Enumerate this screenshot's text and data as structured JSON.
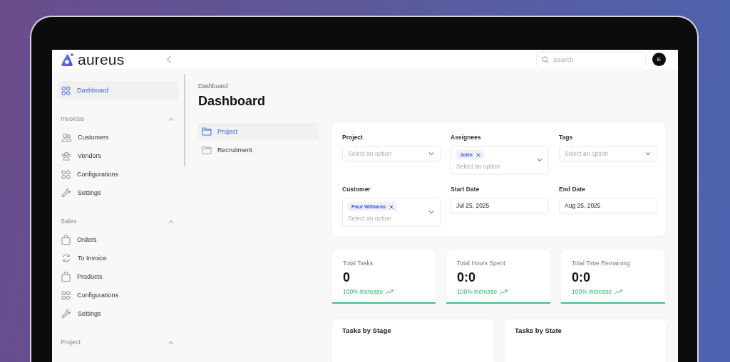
{
  "brand": {
    "name": "aureus"
  },
  "header": {
    "search": {
      "placeholder": "Search"
    },
    "avatar": {
      "initial": "E"
    }
  },
  "sidebar": {
    "top": [
      {
        "label": "Dashboard",
        "kind": "grid",
        "selected": true
      }
    ],
    "sections": [
      {
        "title": "Invoices",
        "expanded": true,
        "items": [
          {
            "label": "Customers",
            "kind": "users",
            "selected": false
          },
          {
            "label": "Vendors",
            "kind": "vendors",
            "selected": false
          },
          {
            "label": "Configurations",
            "kind": "grid",
            "selected": false
          },
          {
            "label": "Settings",
            "kind": "wrench",
            "selected": false
          }
        ]
      },
      {
        "title": "Sales",
        "expanded": true,
        "items": [
          {
            "label": "Orders",
            "kind": "bag",
            "selected": false
          },
          {
            "label": "To Invoice",
            "kind": "refresh",
            "selected": false
          },
          {
            "label": "Products",
            "kind": "bag",
            "selected": false
          },
          {
            "label": "Configurations",
            "kind": "grid",
            "selected": false
          },
          {
            "label": "Settings",
            "kind": "wrench",
            "selected": false
          }
        ]
      },
      {
        "title": "Project",
        "expanded": true
      }
    ]
  },
  "breadcrumb": "Dashboard",
  "page_title": "Dashboard",
  "sub_nav": [
    {
      "label": "Project",
      "selected": true
    },
    {
      "label": "Recruitment",
      "selected": false
    }
  ],
  "filters": [
    {
      "label": "Project",
      "kind": "select",
      "placeholder": "Select an option"
    },
    {
      "label": "Assignees",
      "kind": "multiselect",
      "chips": [
        "John"
      ],
      "placeholder": "Select an option"
    },
    {
      "label": "Tags",
      "kind": "select",
      "placeholder": "Select an option"
    },
    {
      "label": "Customer",
      "kind": "multiselect",
      "chips": [
        "Paul Williams"
      ],
      "placeholder": "Select an option"
    },
    {
      "label": "Start Date",
      "kind": "date",
      "value": "Jul 25, 2025"
    },
    {
      "label": "End Date",
      "kind": "date",
      "value": "Aug 25, 2025"
    }
  ],
  "stats": [
    {
      "label": "Total Tasks",
      "value": "0",
      "trend": "100% increase"
    },
    {
      "label": "Total Hours Spent",
      "value": "0:0",
      "trend": "100% increase"
    },
    {
      "label": "Total Time Remaining",
      "value": "0:0",
      "trend": "100% increase"
    }
  ],
  "panels": [
    {
      "title": "Tasks by Stage"
    },
    {
      "title": "Tasks by State"
    }
  ]
}
